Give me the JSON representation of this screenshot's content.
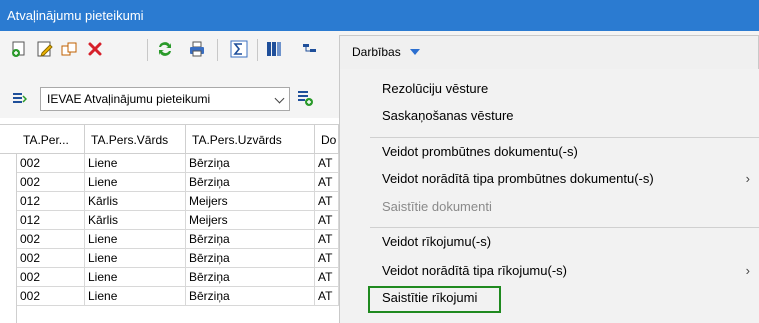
{
  "window": {
    "title": "Atvaļinājumu pieteikumi"
  },
  "toolbar": {
    "icons": [
      "add-icon",
      "edit-icon",
      "copy-icon",
      "delete-icon",
      "refresh-icon",
      "print-icon",
      "sum-icon",
      "columns-icon",
      "tree-icon"
    ],
    "darbibas_label": "Darbības"
  },
  "filter": {
    "selected": "IEVAE Atvaļinājumu pieteikumi"
  },
  "grid": {
    "columns": [
      "TA.Per...",
      "TA.Pers.Vārds",
      "TA.Pers.Uzvārds",
      "Do"
    ],
    "rows": [
      [
        "002",
        "Liene",
        "Bērziņa",
        "AT"
      ],
      [
        "002",
        "Liene",
        "Bērziņa",
        "AT"
      ],
      [
        "012",
        "Kārlis",
        "Meijers",
        "AT"
      ],
      [
        "012",
        "Kārlis",
        "Meijers",
        "AT"
      ],
      [
        "002",
        "Liene",
        "Bērziņa",
        "AT"
      ],
      [
        "002",
        "Liene",
        "Bērziņa",
        "AT"
      ],
      [
        "002",
        "Liene",
        "Bērziņa",
        "AT"
      ],
      [
        "002",
        "Liene",
        "Bērziņa",
        "AT"
      ]
    ]
  },
  "menu": {
    "items": [
      {
        "label": "Rezolūciju vēsture",
        "disabled": false,
        "submenu": false
      },
      {
        "label": "Saskaņošanas vēsture",
        "disabled": false,
        "submenu": false
      },
      {
        "label": "Veidot prombūtnes dokumentu(-s)",
        "disabled": false,
        "submenu": false
      },
      {
        "label": "Veidot norādītā tipa prombūtnes dokumentu(-s)",
        "disabled": false,
        "submenu": true
      },
      {
        "label": "Saistītie dokumenti",
        "disabled": true,
        "submenu": false
      },
      {
        "label": "Veidot rīkojumu(-s)",
        "disabled": false,
        "submenu": false
      },
      {
        "label": "Veidot norādītā tipa rīkojumu(-s)",
        "disabled": false,
        "submenu": true
      },
      {
        "label": "Saistītie rīkojumi",
        "disabled": false,
        "submenu": false
      }
    ],
    "submenu_glyph": "›",
    "highlight_color": "#1f8a1f"
  }
}
